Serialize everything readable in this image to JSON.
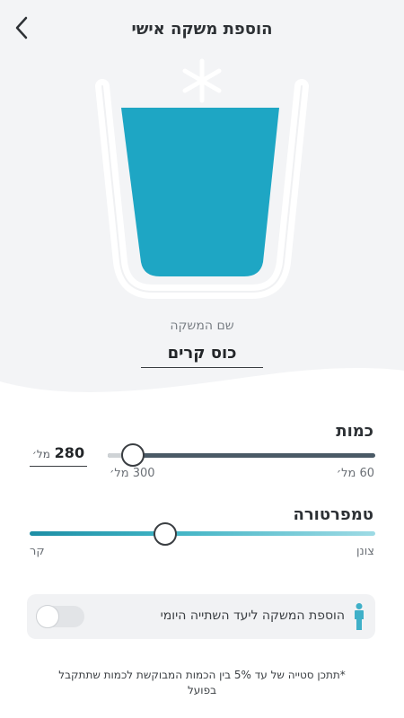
{
  "header": {
    "title": "הוספת משקה אישי",
    "back_icon": "chevron-left-icon"
  },
  "drink": {
    "icon": "snowflake-icon",
    "fill_level": 0.85,
    "fill_color": "#1ea6c4",
    "name_label": "שם המשקה",
    "name_value": "כוס קרים"
  },
  "quantity": {
    "title": "כמות",
    "value": "280",
    "unit": "מל׳",
    "max_label": "300 מל׳",
    "min_label": "60 מל׳",
    "track_color": "#4a5a66"
  },
  "temperature": {
    "title": "טמפרטורה",
    "cold_label": "קר",
    "hot_label": "צונן",
    "level": 0.62,
    "track_colors": [
      "#1d8ea5",
      "#9edbe5"
    ]
  },
  "daily_goal": {
    "label": "הוספת המשקה ליעד השתייה היומי",
    "icon": "person-icon",
    "enabled": false
  },
  "footnote": "*תתכן סטייה של עד 5% בין הכמות המבוקשת לכמות שתתקבל בפועל"
}
